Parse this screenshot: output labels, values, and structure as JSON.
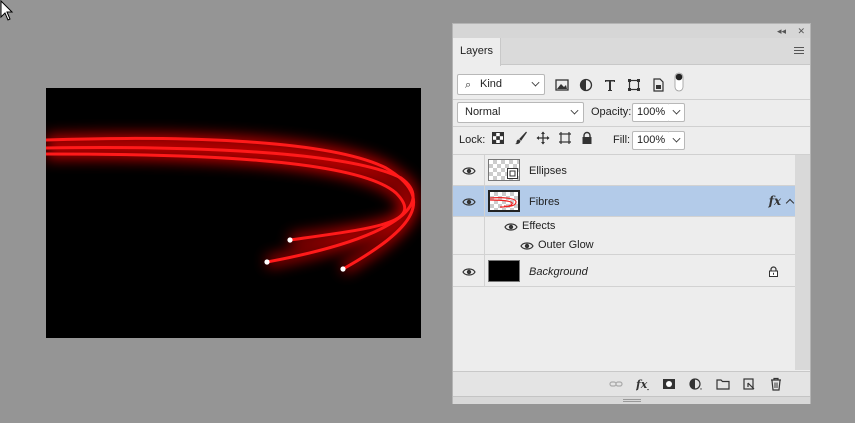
{
  "panel": {
    "tab_label": "Layers",
    "collapse_glyph": "◂◂",
    "close_glyph": "✕"
  },
  "filter": {
    "kind_label": "Kind",
    "icons": [
      "pixel-filter-icon",
      "adjustment-filter-icon",
      "type-filter-icon",
      "shape-filter-icon",
      "smart-object-filter-icon",
      "filter-toggle-icon"
    ]
  },
  "blend": {
    "mode": "Normal",
    "opacity_label": "Opacity:",
    "opacity_value": "100%",
    "fill_label": "Fill:",
    "fill_value": "100%",
    "lock_label": "Lock:"
  },
  "layers": [
    {
      "name": "Ellipses",
      "visible": true,
      "selected": false
    },
    {
      "name": "Fibres",
      "visible": true,
      "selected": true,
      "fx": "fx",
      "effects_label": "Effects",
      "effect_name": "Outer Glow"
    },
    {
      "name": "Background",
      "visible": true,
      "selected": false,
      "locked": true
    }
  ],
  "footer_icons": [
    "link-layers-icon",
    "layer-style-icon",
    "add-mask-icon",
    "adjustment-layer-icon",
    "new-group-icon",
    "new-layer-icon",
    "delete-layer-icon"
  ],
  "colors": {
    "selection": "#b3cbe9",
    "fibre": "#ff1a1a",
    "glow": "#e00000"
  }
}
